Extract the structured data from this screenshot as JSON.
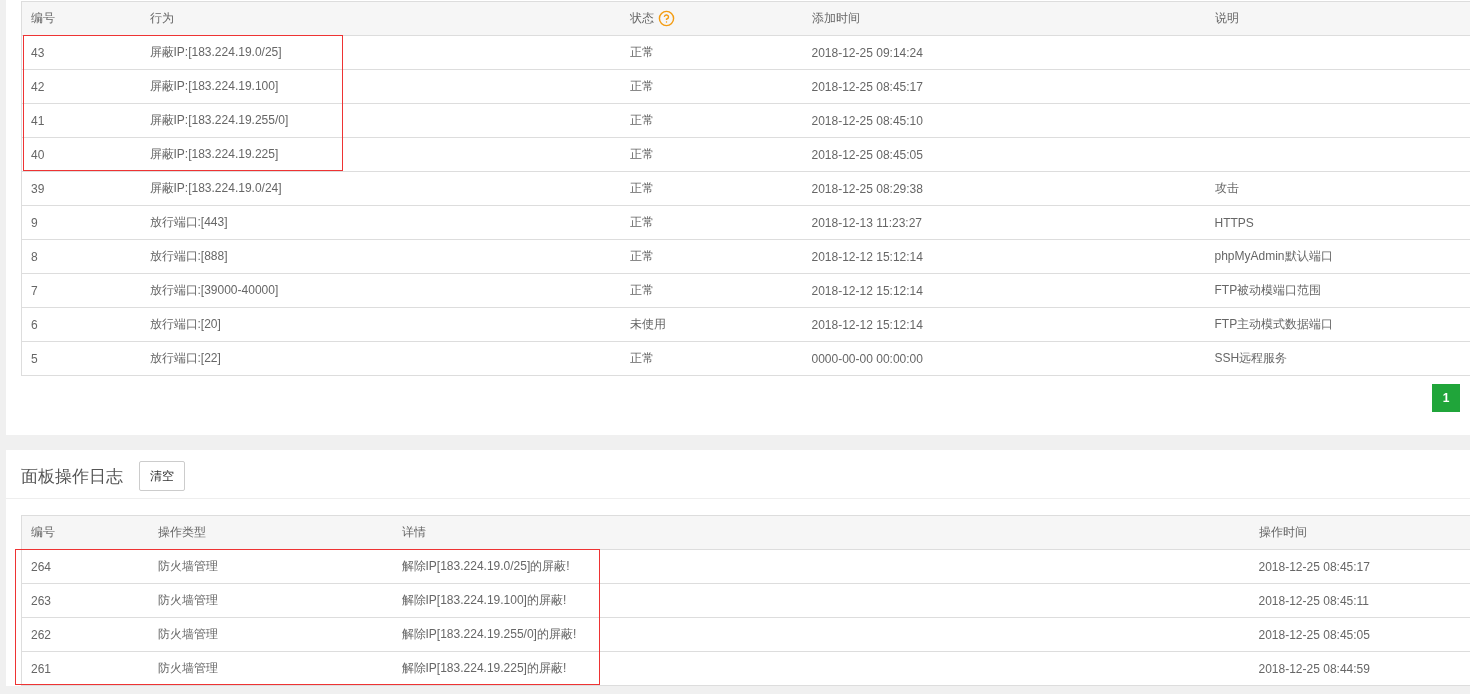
{
  "firewall_table": {
    "columns": [
      {
        "label": "编号"
      },
      {
        "label": "行为"
      },
      {
        "label": "状态",
        "help": true
      },
      {
        "label": "添加时间"
      },
      {
        "label": "说明"
      }
    ],
    "rows": [
      {
        "cells": [
          "43",
          "屏蔽IP:[183.224.19.0/25]",
          "正常",
          "2018-12-25 09:14:24",
          ""
        ],
        "highlighted": true
      },
      {
        "cells": [
          "42",
          "屏蔽IP:[183.224.19.100]",
          "正常",
          "2018-12-25 08:45:17",
          ""
        ],
        "highlighted": true
      },
      {
        "cells": [
          "41",
          "屏蔽IP:[183.224.19.255/0]",
          "正常",
          "2018-12-25 08:45:10",
          ""
        ],
        "highlighted": true
      },
      {
        "cells": [
          "40",
          "屏蔽IP:[183.224.19.225]",
          "正常",
          "2018-12-25 08:45:05",
          ""
        ],
        "highlighted": true
      },
      {
        "cells": [
          "39",
          "屏蔽IP:[183.224.19.0/24]",
          "正常",
          "2018-12-25 08:29:38",
          "攻击"
        ],
        "highlighted": false
      },
      {
        "cells": [
          "9",
          "放行端口:[443]",
          "正常",
          "2018-12-13 11:23:27",
          "HTTPS"
        ],
        "highlighted": false
      },
      {
        "cells": [
          "8",
          "放行端口:[888]",
          "正常",
          "2018-12-12 15:12:14",
          "phpMyAdmin默认端口"
        ],
        "highlighted": false
      },
      {
        "cells": [
          "7",
          "放行端口:[39000-40000]",
          "正常",
          "2018-12-12 15:12:14",
          "FTP被动模端口范围"
        ],
        "highlighted": false
      },
      {
        "cells": [
          "6",
          "放行端口:[20]",
          "未使用",
          "2018-12-12 15:12:14",
          "FTP主动模式数据端口"
        ],
        "highlighted": false
      },
      {
        "cells": [
          "5",
          "放行端口:[22]",
          "正常",
          "0000-00-00 00:00:00",
          "SSH远程服务"
        ],
        "highlighted": false
      }
    ],
    "pagination": [
      {
        "label": "1",
        "selected": true
      }
    ]
  },
  "log_panel": {
    "title": "面板操作日志",
    "clear_button": "清空",
    "columns": [
      {
        "label": "编号"
      },
      {
        "label": "操作类型"
      },
      {
        "label": "详情"
      },
      {
        "label": "操作时间"
      }
    ],
    "rows": [
      {
        "cells": [
          "264",
          "防火墙管理",
          "解除IP[183.224.19.0/25]的屏蔽!",
          "2018-12-25 08:45:17"
        ],
        "highlighted": true
      },
      {
        "cells": [
          "263",
          "防火墙管理",
          "解除IP[183.224.19.100]的屏蔽!",
          "2018-12-25 08:45:11"
        ],
        "highlighted": true
      },
      {
        "cells": [
          "262",
          "防火墙管理",
          "解除IP[183.224.19.255/0]的屏蔽!",
          "2018-12-25 08:45:05"
        ],
        "highlighted": true
      },
      {
        "cells": [
          "261",
          "防火墙管理",
          "解除IP[183.224.19.225]的屏蔽!",
          "2018-12-25 08:44:59"
        ],
        "highlighted": true
      }
    ]
  }
}
